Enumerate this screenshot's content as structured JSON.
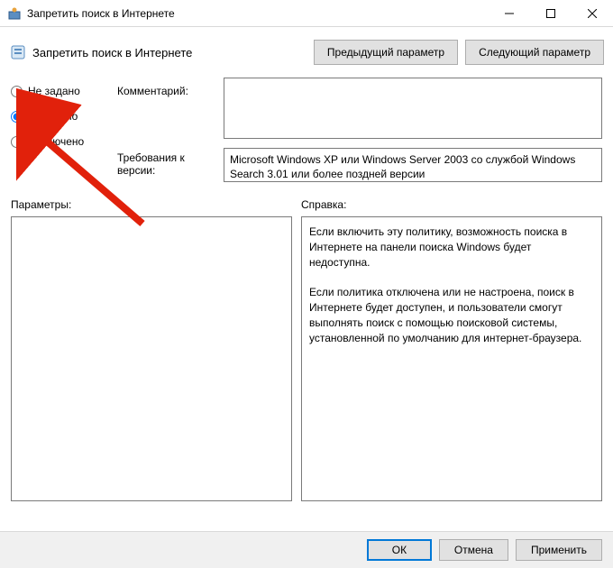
{
  "titlebar": {
    "title": "Запретить поиск в Интернете"
  },
  "header": {
    "title": "Запретить поиск в Интернете",
    "prev_btn": "Предыдущий параметр",
    "next_btn": "Следующий параметр"
  },
  "radios": {
    "not_configured": "Не задано",
    "enabled": "Включено",
    "disabled": "Отключено"
  },
  "labels": {
    "comment": "Комментарий:",
    "requirements": "Требования к версии:",
    "options": "Параметры:",
    "help": "Справка:"
  },
  "fields": {
    "comment_value": "",
    "requirements_text": "Microsoft Windows XP или Windows Server 2003 со службой Windows Search 3.01 или более поздней версии",
    "options_text": "",
    "help_text": "Если включить эту политику, возможность поиска в Интернете на панели поиска Windows будет недоступна.\n\nЕсли политика отключена или не настроена, поиск в Интернете будет доступен, и пользователи смогут выполнять поиск с помощью поисковой системы, установленной по умолчанию для интернет-браузера."
  },
  "footer": {
    "ok": "ОК",
    "cancel": "Отмена",
    "apply": "Применить"
  }
}
